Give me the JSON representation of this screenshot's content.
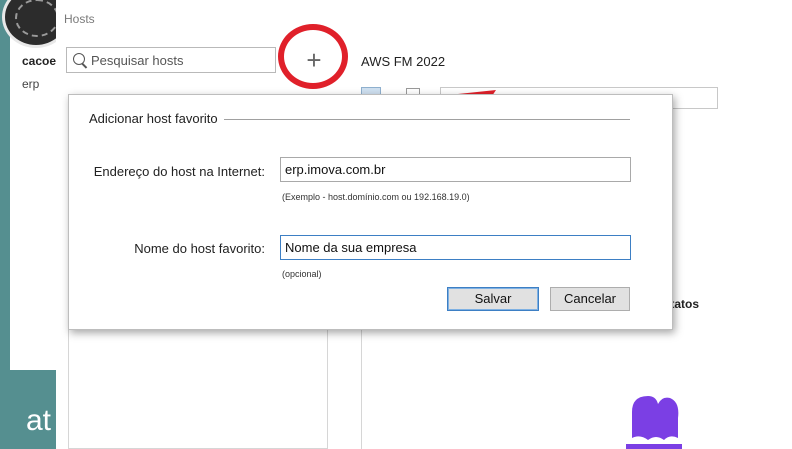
{
  "background": {
    "left_label1": "cacoes",
    "left_label2": "erp",
    "bottom_text": "at"
  },
  "window": {
    "title": "Hosts",
    "search_placeholder": "Pesquisar hosts",
    "add_symbol": "+",
    "profile_name": "AWS FM 2022",
    "contacts_label": "contatos"
  },
  "dialog": {
    "title": "Adicionar host favorito",
    "host_label": "Endereço do host na Internet:",
    "host_value": "erp.imova.com.br",
    "host_hint": "(Exemplo - host.domínio.com ou 192.168.19.0)",
    "name_label": "Nome do host favorito:",
    "name_value": "Nome da sua empresa",
    "name_hint": "(opcional)",
    "save_label": "Salvar",
    "cancel_label": "Cancelar"
  },
  "colors": {
    "annotation_red": "#e0202a",
    "focus_blue": "#3d7fc4",
    "background_teal": "#4f8a8b",
    "logo_purple": "#7b3fe4"
  }
}
